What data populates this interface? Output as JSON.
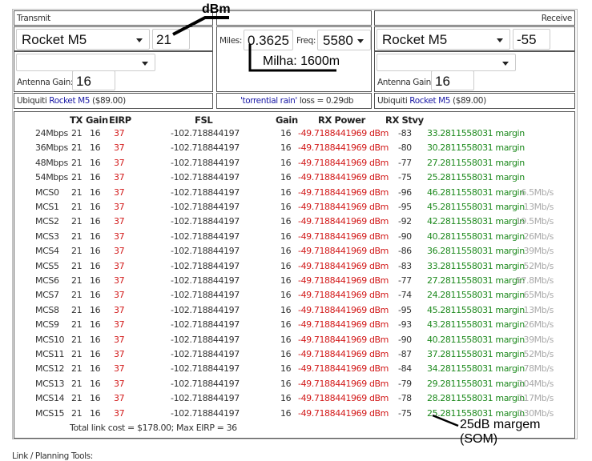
{
  "transmit": {
    "title": "Transmit",
    "device": "Rocket M5",
    "power": "21",
    "antenna": "",
    "antenna_gain_label": "Antenna Gain:",
    "antenna_gain": "16",
    "vendor": "Ubiquiti",
    "model_link": "Rocket M5",
    "price": "($89.00)"
  },
  "link": {
    "miles_label": "Miles:",
    "miles": "0.3625",
    "freq_label": "Freq:",
    "freq": "5580",
    "rain_link": "'torrential rain'",
    "loss_text": "loss = 0.29db"
  },
  "receive": {
    "title": "Receive",
    "device": "Rocket M5",
    "sensitivity": "-55",
    "antenna": "",
    "antenna_gain_label": "Antenna Gain:",
    "antenna_gain": "16",
    "vendor": "Ubiquiti",
    "model_link": "Rocket M5",
    "price": "($89.00)"
  },
  "table": {
    "headers": {
      "tx": "TX",
      "gain": "Gain",
      "eirp": "EIRP",
      "fsl": "FSL",
      "rx_gain": "Gain",
      "rx_power": "RX Power",
      "rx_stvy": "RX Stvy"
    },
    "rows": [
      [
        "24Mbps",
        "21",
        "16",
        "37",
        "-102.718844197",
        "16",
        "-49.7188441969 dBm",
        "-83",
        "33.2811558031 margin",
        ""
      ],
      [
        "36Mbps",
        "21",
        "16",
        "37",
        "-102.718844197",
        "16",
        "-49.7188441969 dBm",
        "-80",
        "30.2811558031 margin",
        ""
      ],
      [
        "48Mbps",
        "21",
        "16",
        "37",
        "-102.718844197",
        "16",
        "-49.7188441969 dBm",
        "-77",
        "27.2811558031 margin",
        ""
      ],
      [
        "54Mbps",
        "21",
        "16",
        "37",
        "-102.718844197",
        "16",
        "-49.7188441969 dBm",
        "-75",
        "25.2811558031 margin",
        ""
      ],
      [
        "MCS0",
        "21",
        "16",
        "37",
        "-102.718844197",
        "16",
        "-49.7188441969 dBm",
        "-96",
        "46.2811558031 margin",
        "6.5Mb/s"
      ],
      [
        "MCS1",
        "21",
        "16",
        "37",
        "-102.718844197",
        "16",
        "-49.7188441969 dBm",
        "-95",
        "45.2811558031 margin",
        "13Mb/s"
      ],
      [
        "MCS2",
        "21",
        "16",
        "37",
        "-102.718844197",
        "16",
        "-49.7188441969 dBm",
        "-92",
        "42.2811558031 margin",
        "19.5Mb/s"
      ],
      [
        "MCS3",
        "21",
        "16",
        "37",
        "-102.718844197",
        "16",
        "-49.7188441969 dBm",
        "-90",
        "40.2811558031 margin",
        "26Mb/s"
      ],
      [
        "MCS4",
        "21",
        "16",
        "37",
        "-102.718844197",
        "16",
        "-49.7188441969 dBm",
        "-86",
        "36.2811558031 margin",
        "39Mb/s"
      ],
      [
        "MCS5",
        "21",
        "16",
        "37",
        "-102.718844197",
        "16",
        "-49.7188441969 dBm",
        "-83",
        "33.2811558031 margin",
        "52Mb/s"
      ],
      [
        "MCS6",
        "21",
        "16",
        "37",
        "-102.718844197",
        "16",
        "-49.7188441969 dBm",
        "-77",
        "27.2811558031 margin",
        "57.8Mb/s"
      ],
      [
        "MCS7",
        "21",
        "16",
        "37",
        "-102.718844197",
        "16",
        "-49.7188441969 dBm",
        "-74",
        "24.2811558031 margin",
        "65Mb/s"
      ],
      [
        "MCS8",
        "21",
        "16",
        "37",
        "-102.718844197",
        "16",
        "-49.7188441969 dBm",
        "-95",
        "45.2811558031 margin",
        "13Mb/s"
      ],
      [
        "MCS9",
        "21",
        "16",
        "37",
        "-102.718844197",
        "16",
        "-49.7188441969 dBm",
        "-93",
        "43.2811558031 margin",
        "26Mb/s"
      ],
      [
        "MCS10",
        "21",
        "16",
        "37",
        "-102.718844197",
        "16",
        "-49.7188441969 dBm",
        "-90",
        "40.2811558031 margin",
        "39Mb/s"
      ],
      [
        "MCS11",
        "21",
        "16",
        "37",
        "-102.718844197",
        "16",
        "-49.7188441969 dBm",
        "-87",
        "37.2811558031 margin",
        "52Mb/s"
      ],
      [
        "MCS12",
        "21",
        "16",
        "37",
        "-102.718844197",
        "16",
        "-49.7188441969 dBm",
        "-84",
        "34.2811558031 margin",
        "78Mb/s"
      ],
      [
        "MCS13",
        "21",
        "16",
        "37",
        "-102.718844197",
        "16",
        "-49.7188441969 dBm",
        "-79",
        "29.2811558031 margin",
        "104Mb/s"
      ],
      [
        "MCS14",
        "21",
        "16",
        "37",
        "-102.718844197",
        "16",
        "-49.7188441969 dBm",
        "-78",
        "28.2811558031 margin",
        "117Mb/s"
      ],
      [
        "MCS15",
        "21",
        "16",
        "37",
        "-102.718844197",
        "16",
        "-49.7188441969 dBm",
        "-75",
        "25.2811558031 margin",
        "130Mb/s"
      ]
    ],
    "total": "Total link cost = $178.00; Max EIRP = 36"
  },
  "footer": {
    "tools_label": "Link / Planning Tools:"
  },
  "annotations": {
    "dbm": "dBm",
    "milha": "Milha: 1600m",
    "margem": "25dB margem",
    "som": "(SOM)"
  }
}
